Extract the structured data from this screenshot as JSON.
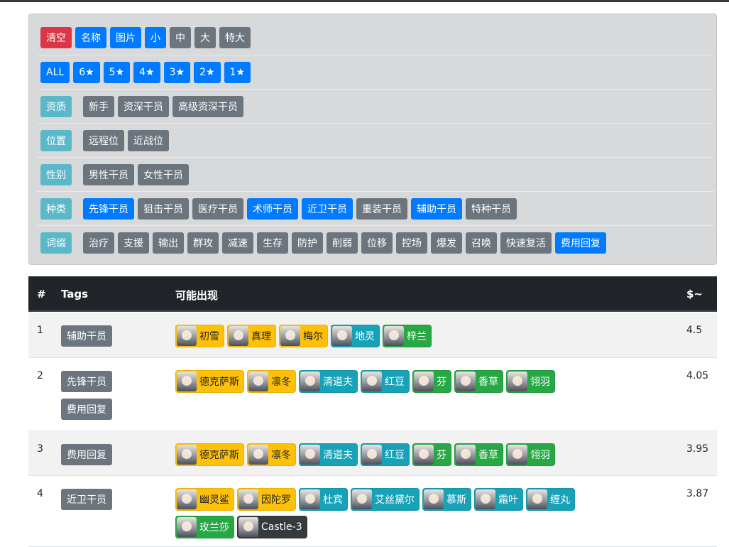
{
  "controls": {
    "clear": "清空",
    "name": "名称",
    "image": "图片",
    "size_small": "小",
    "size_medium": "中",
    "size_large": "大",
    "size_xlarge": "特大"
  },
  "stars": [
    "ALL",
    "6★",
    "5★",
    "4★",
    "3★",
    "2★",
    "1★"
  ],
  "filters": {
    "qualification": {
      "label": "资质",
      "options": [
        "新手",
        "资深干员",
        "高级资深干员"
      ]
    },
    "position": {
      "label": "位置",
      "options": [
        "远程位",
        "近战位"
      ]
    },
    "gender": {
      "label": "性别",
      "options": [
        "男性干员",
        "女性干员"
      ]
    },
    "class": {
      "label": "种类",
      "options": [
        "先锋干员",
        "狙击干员",
        "医疗干员",
        "术师干员",
        "近卫干员",
        "重装干员",
        "辅助干员",
        "特种干员"
      ],
      "selected": [
        true,
        false,
        false,
        true,
        true,
        false,
        true,
        false
      ]
    },
    "affix": {
      "label": "词缀",
      "options": [
        "治疗",
        "支援",
        "输出",
        "群攻",
        "减速",
        "生存",
        "防护",
        "削弱",
        "位移",
        "控场",
        "爆发",
        "召唤",
        "快速复活",
        "费用回复"
      ],
      "selected": [
        false,
        false,
        false,
        false,
        false,
        false,
        false,
        false,
        false,
        false,
        false,
        false,
        false,
        true
      ]
    }
  },
  "table": {
    "headers": {
      "num": "#",
      "tags": "Tags",
      "possible": "可能出现",
      "score": "$~"
    },
    "rows": [
      {
        "num": "1",
        "tags": [
          "辅助干员"
        ],
        "score": "4.5",
        "ops": [
          {
            "name": "初雪",
            "rarity": 5
          },
          {
            "name": "真理",
            "rarity": 5
          },
          {
            "name": "梅尔",
            "rarity": 5
          },
          {
            "name": "地灵",
            "rarity": 4
          },
          {
            "name": "梓兰",
            "rarity": 3
          }
        ]
      },
      {
        "num": "2",
        "tags": [
          "先锋干员",
          "费用回复"
        ],
        "score": "4.05",
        "ops": [
          {
            "name": "德克萨斯",
            "rarity": 5
          },
          {
            "name": "凛冬",
            "rarity": 5
          },
          {
            "name": "清道夫",
            "rarity": 4
          },
          {
            "name": "红豆",
            "rarity": 4
          },
          {
            "name": "芬",
            "rarity": 3
          },
          {
            "name": "香草",
            "rarity": 3
          },
          {
            "name": "翎羽",
            "rarity": 3
          }
        ]
      },
      {
        "num": "3",
        "tags": [
          "费用回复"
        ],
        "score": "3.95",
        "ops": [
          {
            "name": "德克萨斯",
            "rarity": 5
          },
          {
            "name": "凛冬",
            "rarity": 5
          },
          {
            "name": "清道夫",
            "rarity": 4
          },
          {
            "name": "红豆",
            "rarity": 4
          },
          {
            "name": "芬",
            "rarity": 3
          },
          {
            "name": "香草",
            "rarity": 3
          },
          {
            "name": "翎羽",
            "rarity": 3
          }
        ]
      },
      {
        "num": "4",
        "tags": [
          "近卫干员"
        ],
        "score": "3.87",
        "ops": [
          {
            "name": "幽灵鲨",
            "rarity": 5
          },
          {
            "name": "因陀罗",
            "rarity": 5
          },
          {
            "name": "杜宾",
            "rarity": 4
          },
          {
            "name": "艾丝黛尔",
            "rarity": 4
          },
          {
            "name": "慕斯",
            "rarity": 4
          },
          {
            "name": "霜叶",
            "rarity": 4
          },
          {
            "name": "缠丸",
            "rarity": 4
          },
          {
            "name": "玫兰莎",
            "rarity": 3
          },
          {
            "name": "Castle-3",
            "rarity": 6
          }
        ]
      }
    ]
  },
  "colors": {
    "primary": "#007bff",
    "secondary": "#6c757d",
    "danger": "#dc3545",
    "info": "#5bb8c8",
    "rarity5": "#ffc107",
    "rarity4": "#17a2b8",
    "rarity3": "#28a745",
    "robot": "#343a40"
  }
}
